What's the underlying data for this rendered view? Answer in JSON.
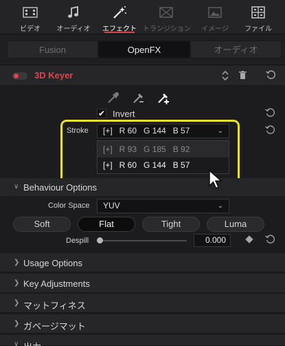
{
  "tabs": [
    {
      "label": "ビデオ",
      "icon": "film-icon",
      "state": "normal"
    },
    {
      "label": "オーディオ",
      "icon": "music-note-icon",
      "state": "normal"
    },
    {
      "label": "エフェクト",
      "icon": "magic-wand-icon",
      "state": "active"
    },
    {
      "label": "トランジション",
      "icon": "transition-icon",
      "state": "disabled"
    },
    {
      "label": "イメージ",
      "icon": "image-icon",
      "state": "disabled"
    },
    {
      "label": "ファイル",
      "icon": "file-cabinet-icon",
      "state": "normal"
    }
  ],
  "segments": {
    "fusion": "Fusion",
    "openfx": "OpenFX",
    "audio": "オーディオ",
    "active": "OpenFX"
  },
  "effect": {
    "title": "3D Keyer",
    "enabled": true
  },
  "pickers": [
    "pick-color-icon",
    "pick-subtract-icon",
    "pick-add-icon"
  ],
  "invert": {
    "label": "Invert",
    "checked": true
  },
  "stroke": {
    "label": "Stroke",
    "selected": "[+]   R 60   G 144   B 57",
    "options": [
      "[+]   R 93   G 185   B 92",
      "[+]   R 60   G 144   B 57"
    ]
  },
  "behaviour": {
    "title": "Behaviour Options",
    "color_space_label": "Color Space",
    "color_space_value": "YUV",
    "modes": [
      "Soft",
      "Flat",
      "Tight",
      "Luma"
    ],
    "active_mode": "Flat",
    "despill_label": "Despill",
    "despill_value": "0.000"
  },
  "sections": [
    "Usage Options",
    "Key Adjustments",
    "マットフィネス",
    "ガベージマット",
    "出力"
  ],
  "colors": {
    "accent_red": "#e0434b",
    "highlight_yellow": "#e7e033"
  }
}
